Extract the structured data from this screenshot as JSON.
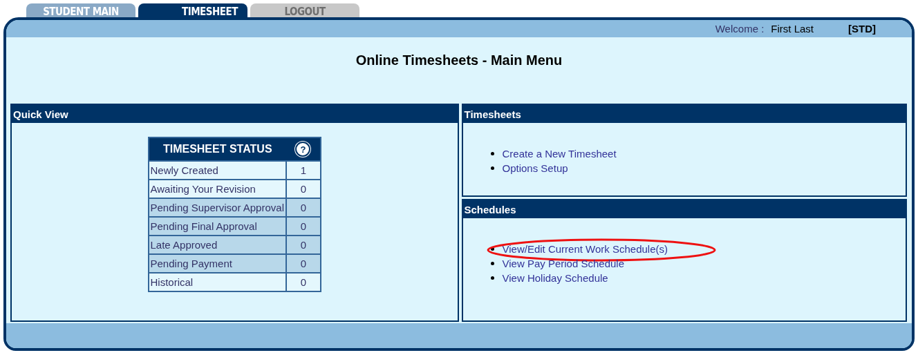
{
  "tabs": [
    {
      "label": "STUDENT MAIN",
      "selected": false,
      "disabled": false
    },
    {
      "label": "TIMESHEET",
      "selected": true,
      "disabled": false
    },
    {
      "label": "LOGOUT",
      "selected": false,
      "disabled": true
    }
  ],
  "header": {
    "welcome_label": "Welcome :",
    "user_name": "First Last",
    "role": "[STD]"
  },
  "title": "Online Timesheets - Main Menu",
  "quick_view": {
    "title": "Quick View",
    "table": {
      "heading": "TIMESHEET STATUS",
      "help_icon": "?",
      "rows": [
        {
          "label": "Newly Created",
          "count": "1",
          "highlighted": false
        },
        {
          "label": "Awaiting Your Revision",
          "count": "0",
          "highlighted": false
        },
        {
          "label": "Pending Supervisor Approval",
          "count": "0",
          "highlighted": true
        },
        {
          "label": "Pending Final Approval",
          "count": "0",
          "highlighted": true
        },
        {
          "label": "Late Approved",
          "count": "0",
          "highlighted": true
        },
        {
          "label": "Pending Payment",
          "count": "0",
          "highlighted": true
        },
        {
          "label": "Historical",
          "count": "0",
          "highlighted": false
        }
      ]
    }
  },
  "timesheets": {
    "title": "Timesheets",
    "links": [
      {
        "label": "Create a New Timesheet",
        "circled": false
      },
      {
        "label": "Options Setup",
        "circled": false
      }
    ]
  },
  "schedules": {
    "title": "Schedules",
    "links": [
      {
        "label": "View/Edit Current Work Schedule(s)",
        "circled": true
      },
      {
        "label": "View Pay Period Schedule",
        "circled": false
      },
      {
        "label": "View Holiday Schedule",
        "circled": false
      }
    ]
  }
}
